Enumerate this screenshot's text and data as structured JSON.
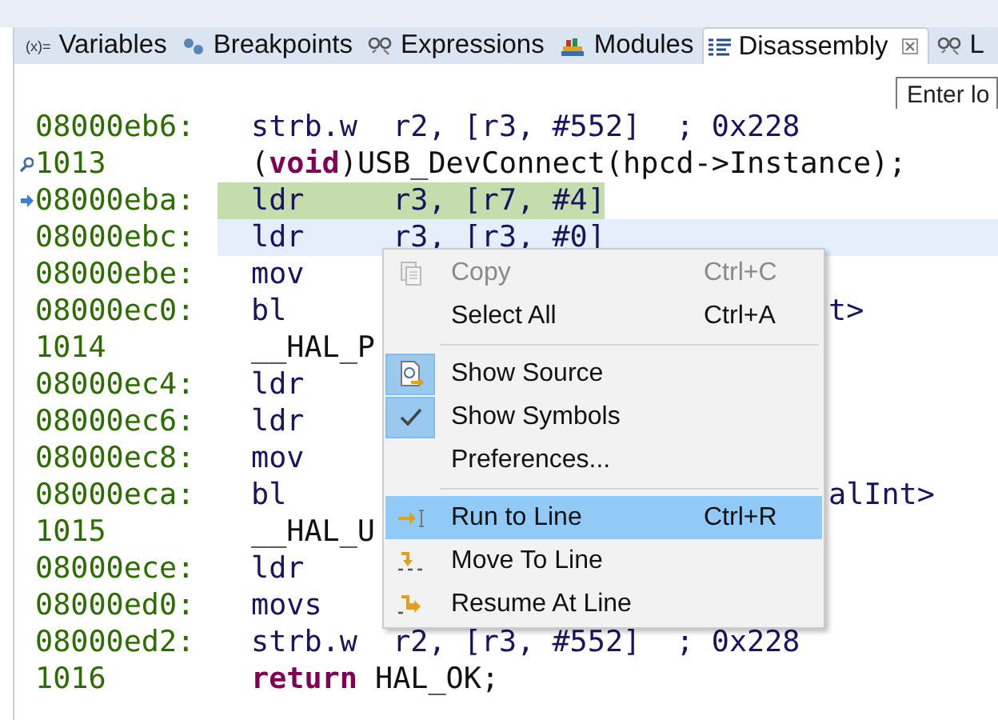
{
  "tabs": [
    {
      "label": "Variables",
      "icon_text": "(x)=",
      "selected": false,
      "closable": false
    },
    {
      "label": "Breakpoints",
      "selected": false,
      "closable": false
    },
    {
      "label": "Expressions",
      "selected": false,
      "closable": false
    },
    {
      "label": "Modules",
      "selected": false,
      "closable": false
    },
    {
      "label": "Disassembly",
      "selected": true,
      "closable": true
    },
    {
      "label": "L",
      "selected": false,
      "closable": false
    }
  ],
  "address_field": {
    "placeholder": "Enter lo"
  },
  "rows": [
    {
      "address": "08000eb6:",
      "code": "strb.w  r2, [r3, #552]  ; 0x228"
    },
    {
      "address": "1013",
      "code": "(**void**)USB_DevConnect(hpcd->Instance);",
      "kind": "source",
      "pinned": true
    },
    {
      "address": "08000eba:",
      "code": "ldr     r3, [r7, #4]",
      "kind": "pc"
    },
    {
      "address": "08000ebc:",
      "code": "ldr     r3, [r3, #0]",
      "kind": "current"
    },
    {
      "address": "08000ebe:",
      "code": "mov"
    },
    {
      "address": "08000ec0:",
      "code": "bl",
      "tail": "t>"
    },
    {
      "address": "1014",
      "code": "__HAL_P",
      "kind": "source"
    },
    {
      "address": "08000ec4:",
      "code": "ldr"
    },
    {
      "address": "08000ec6:",
      "code": "ldr"
    },
    {
      "address": "08000ec8:",
      "code": "mov"
    },
    {
      "address": "08000eca:",
      "code": "bl",
      "tail": "alInt>"
    },
    {
      "address": "1015",
      "code": "__HAL_U",
      "kind": "source"
    },
    {
      "address": "08000ece:",
      "code": "ldr"
    },
    {
      "address": "08000ed0:",
      "code": "movs"
    },
    {
      "address": "08000ed2:",
      "code": "strb.w  r2, [r3, #552]  ; 0x228"
    },
    {
      "address": "1016",
      "code": "**return** HAL_OK;",
      "kind": "source"
    }
  ],
  "context_menu": {
    "items": [
      {
        "label": "Copy",
        "shortcut": "Ctrl+C",
        "disabled": true,
        "checked": false,
        "selected": false
      },
      {
        "label": "Select All",
        "shortcut": "Ctrl+A",
        "disabled": false,
        "checked": false,
        "selected": false,
        "separator_after": true
      },
      {
        "label": "Show Source",
        "disabled": false,
        "checked": true,
        "selected": false
      },
      {
        "label": "Show Symbols",
        "disabled": false,
        "checked": true,
        "selected": false
      },
      {
        "label": "Preferences...",
        "disabled": false,
        "checked": false,
        "selected": false,
        "separator_after": true
      },
      {
        "label": "Run to Line",
        "shortcut": "Ctrl+R",
        "disabled": false,
        "checked": false,
        "selected": true
      },
      {
        "label": "Move To Line",
        "disabled": false,
        "checked": false,
        "selected": false
      },
      {
        "label": "Resume At Line",
        "disabled": false,
        "checked": false,
        "selected": false
      }
    ]
  }
}
